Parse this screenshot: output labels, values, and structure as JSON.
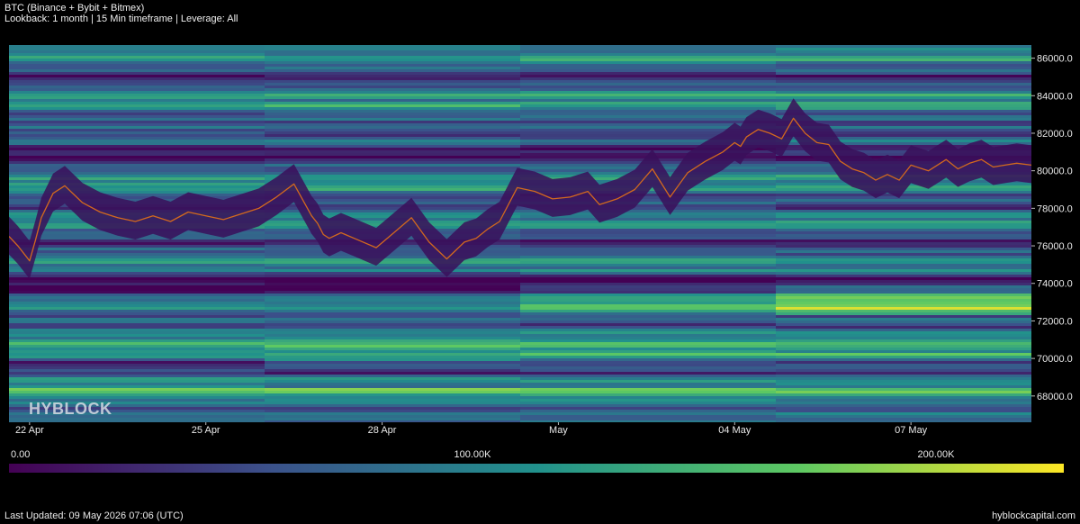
{
  "header": {
    "title": "BTC (Binance + Bybit + Bitmex)",
    "subtitle": "Lookback: 1 month | 15 Min timeframe | Leverage: All"
  },
  "watermark": "HYBLOCK",
  "footer": {
    "last_updated": "Last Updated: 09 May 2026 07:06 (UTC)",
    "site": "hyblockcapital.com"
  },
  "colorbar": {
    "min_label": "0.00",
    "mid_label": "100.00K",
    "max_label": "200.00K",
    "colors": [
      "#440154",
      "#3b528b",
      "#21918c",
      "#5ec962",
      "#fde725"
    ]
  },
  "chart_data": {
    "type": "heatmap",
    "title": "BTC (Binance + Bybit + Bitmex)",
    "subtitle": "Lookback: 1 month | 15 Min timeframe | Leverage: All",
    "x_tick_labels": [
      "22 Apr",
      "25 Apr",
      "28 Apr",
      "May",
      "04 May",
      "07 May"
    ],
    "x_tick_index": [
      0.0,
      3.0,
      6.0,
      9.0,
      12.0,
      15.0
    ],
    "x_range": [
      -0.35,
      17.05
    ],
    "y_tick_labels": [
      "86000.0",
      "84000.0",
      "82000.0",
      "80000.0",
      "78000.0",
      "76000.0",
      "74000.0",
      "72000.0",
      "70000.0",
      "68000.0"
    ],
    "y_ticks": [
      86000,
      84000,
      82000,
      80000,
      78000,
      76000,
      74000,
      72000,
      70000,
      68000
    ],
    "ylim": [
      66600,
      86700
    ],
    "colorbar_range": [
      0,
      220000
    ],
    "price_series": {
      "name": "BTC price",
      "color": "#d2691e",
      "x": [
        -0.35,
        -0.2,
        0.0,
        0.1,
        0.2,
        0.4,
        0.6,
        0.9,
        1.2,
        1.5,
        1.8,
        2.1,
        2.4,
        2.7,
        3.0,
        3.3,
        3.6,
        3.9,
        4.2,
        4.5,
        4.8,
        4.9,
        5.0,
        5.1,
        5.3,
        5.6,
        5.9,
        6.2,
        6.5,
        6.8,
        7.1,
        7.4,
        7.6,
        7.8,
        8.0,
        8.3,
        8.6,
        8.9,
        9.2,
        9.5,
        9.7,
        10.0,
        10.3,
        10.6,
        10.9,
        11.2,
        11.5,
        11.8,
        12.0,
        12.1,
        12.2,
        12.4,
        12.6,
        12.8,
        13.0,
        13.2,
        13.4,
        13.6,
        13.8,
        14.0,
        14.2,
        14.4,
        14.6,
        14.8,
        15.0,
        15.3,
        15.6,
        15.8,
        16.0,
        16.2,
        16.4,
        16.6,
        16.8,
        17.05
      ],
      "y": [
        76500,
        76000,
        75200,
        76300,
        77500,
        78800,
        79200,
        78300,
        77800,
        77500,
        77300,
        77600,
        77300,
        77800,
        77600,
        77400,
        77700,
        78000,
        78600,
        79300,
        77600,
        77200,
        76600,
        76400,
        76700,
        76300,
        75900,
        76700,
        77500,
        76200,
        75300,
        76200,
        76400,
        76900,
        77300,
        79100,
        78900,
        78500,
        78600,
        78900,
        78200,
        78500,
        79000,
        80100,
        78600,
        79900,
        80500,
        81000,
        81500,
        81300,
        81800,
        82200,
        82000,
        81700,
        82800,
        82000,
        81500,
        81400,
        80500,
        80100,
        79900,
        79500,
        79800,
        79500,
        80300,
        80000,
        80600,
        80100,
        80400,
        80600,
        80200,
        80300,
        80400,
        80300
      ]
    },
    "color_scale": "viridis",
    "grid": false,
    "legend": "none"
  }
}
